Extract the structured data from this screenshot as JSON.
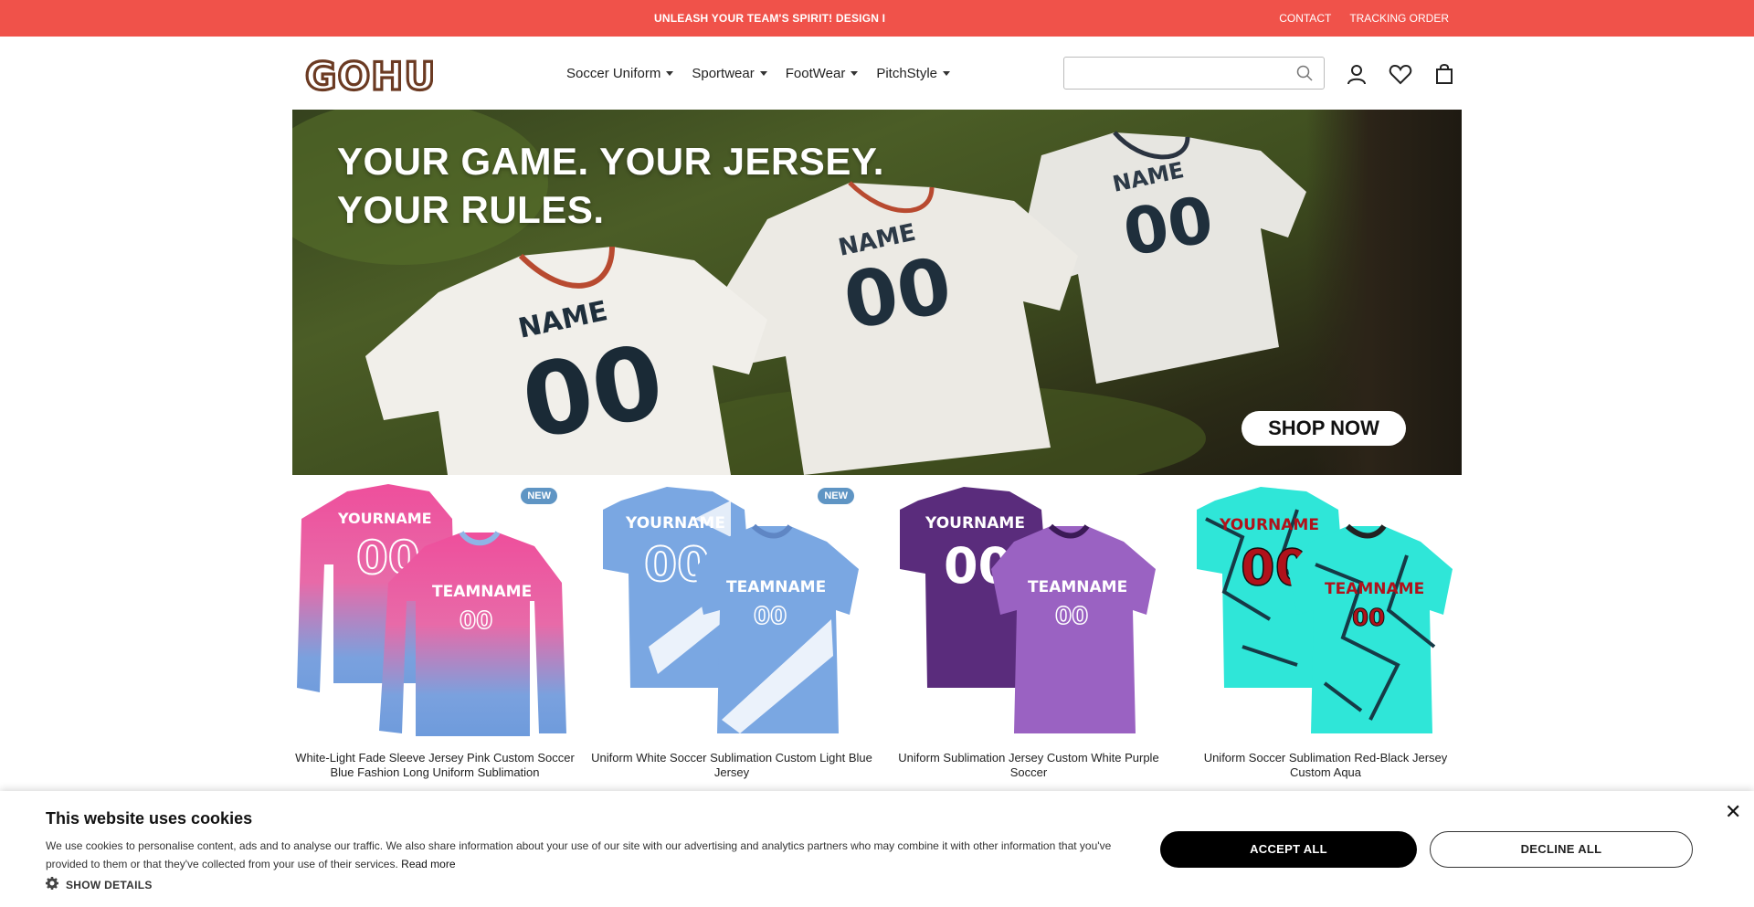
{
  "topbar": {
    "promo": "UNLEASH YOUR TEAM'S SPIRIT! DESIGN I",
    "contact": "CONTACT",
    "tracking": "TRACKING ORDER"
  },
  "header": {
    "logo": "GOHU",
    "nav": [
      "Soccer Uniform",
      "Sportwear",
      "FootWear",
      "PitchStyle"
    ],
    "search_placeholder": "",
    "icons": [
      "search-icon",
      "user-icon",
      "heart-icon",
      "bag-icon"
    ]
  },
  "hero": {
    "line1": "YOUR GAME. YOUR JERSEY.",
    "line2": "YOUR RULES.",
    "shirt_name": "NAME",
    "shirt_number": "00",
    "cta": "SHOP NOW"
  },
  "products": [
    {
      "badge": "NEW",
      "title": "White-Light Fade Sleeve Jersey Pink Custom Soccer Blue Fashion Long Uniform Sublimation",
      "back_text": "YOURNAME",
      "front_text": "TEAMNAME",
      "number": "00"
    },
    {
      "badge": "NEW",
      "title": "Uniform White Soccer Sublimation Custom Light Blue Jersey",
      "back_text": "YOURNAME",
      "front_text": "TEAMNAME",
      "number": "00"
    },
    {
      "badge": "",
      "title": "Uniform Sublimation Jersey Custom White Purple Soccer",
      "back_text": "YOURNAME",
      "front_text": "TEAMNAME",
      "number": "00"
    },
    {
      "badge": "",
      "title": "Uniform Soccer Sublimation Red-Black Jersey Custom Aqua",
      "back_text": "YOURNAME",
      "front_text": "TEAMNAME",
      "number": "00"
    }
  ],
  "cookie": {
    "title": "This website uses cookies",
    "body": "We use cookies to personalise content, ads and to analyse our traffic. We also share information about your use of our site with our advertising and analytics partners who may combine it with other information that you've provided to them or that they've collected from your use of their services.",
    "read_more": "Read more",
    "show_details": "SHOW DETAILS",
    "accept": "ACCEPT ALL",
    "decline": "DECLINE ALL",
    "close": "✕"
  },
  "colors": {
    "topbar": "#f0524a",
    "logo": "#6b3a22",
    "badge": "#5f95c4"
  }
}
